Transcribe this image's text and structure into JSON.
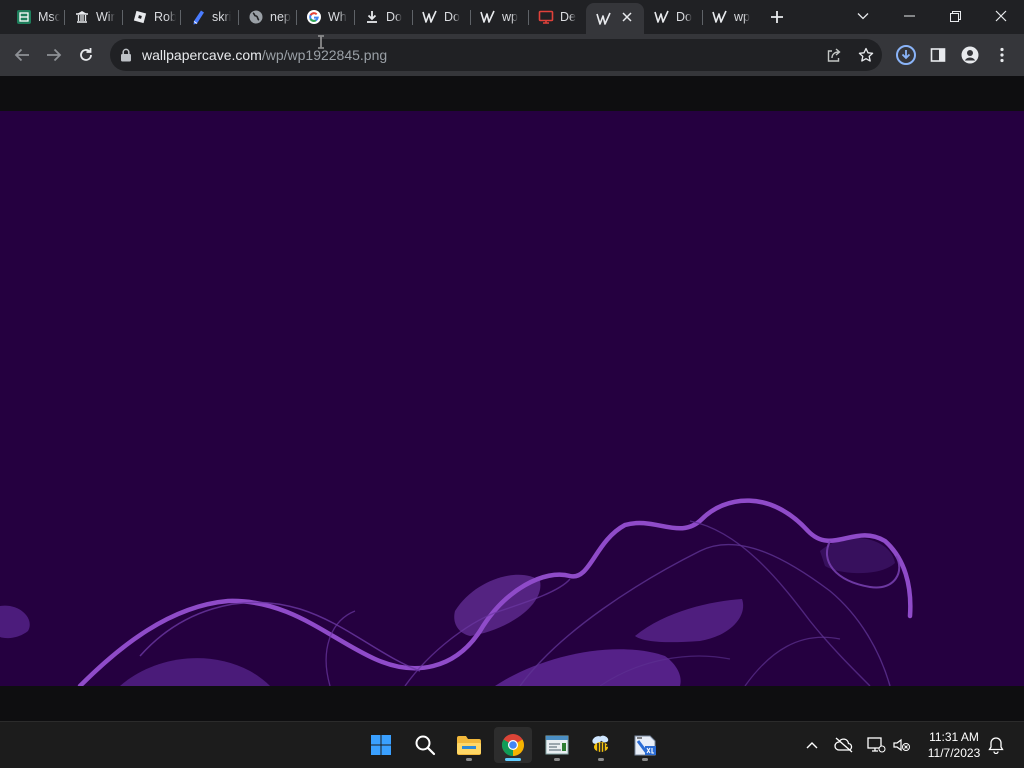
{
  "browser": {
    "tabs": [
      {
        "title": "Msc",
        "icon": "spreadsheet-icon",
        "color": "#1e7f5c"
      },
      {
        "title": "Wir",
        "icon": "wikipedia-icon",
        "color": "#e8eaed"
      },
      {
        "title": "Rob",
        "icon": "roblox-icon",
        "color": "#e8eaed"
      },
      {
        "title": "skri",
        "icon": "skribbl-icon",
        "color": "#4a7cff"
      },
      {
        "title": "nep",
        "icon": "globe-icon",
        "color": "#9aa0a6"
      },
      {
        "title": "Wh",
        "icon": "google-icon",
        "color": "#4285f4"
      },
      {
        "title": "Do",
        "icon": "download-icon",
        "color": "#e8eaed"
      },
      {
        "title": "Do",
        "icon": "wallpapercave-icon",
        "color": "#e8eaed"
      },
      {
        "title": "wp",
        "icon": "wallpapercave-icon",
        "color": "#e8eaed"
      },
      {
        "title": "De",
        "icon": "monitor-icon",
        "color": "#e0413a"
      },
      {
        "title": "",
        "icon": "wallpapercave-icon",
        "color": "#e8eaed",
        "active": true
      },
      {
        "title": "Do",
        "icon": "wallpapercave-icon",
        "color": "#e8eaed"
      },
      {
        "title": "wp",
        "icon": "wallpapercave-icon",
        "color": "#e8eaed"
      }
    ],
    "address": {
      "host": "wallpapercave.com",
      "path": "/wp/wp1922845.png"
    }
  },
  "taskbar": {
    "apps": [
      "windows-start-icon",
      "search-icon",
      "file-explorer-icon",
      "chrome-icon",
      "notepad-icon",
      "bee-app-icon",
      "calculator-xp-icon"
    ],
    "clock": {
      "time": "11:31 AM",
      "date": "11/7/2023"
    }
  },
  "colors": {
    "wallpaper": "#250040",
    "wave": "#7d3fb3",
    "accent": "#60cdff"
  }
}
